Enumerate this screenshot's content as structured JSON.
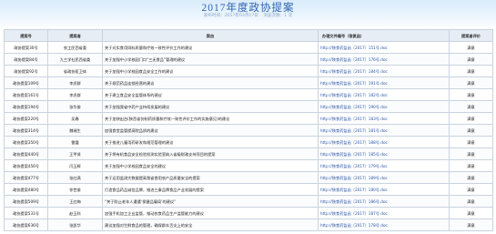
{
  "banner": {
    "title": "2017年度政协提案",
    "meta_left": "发布时间：2017年03月17日",
    "meta_right": "浏览次数：1 次"
  },
  "columns": [
    "提案号",
    "提案者",
    "案由",
    "办理文件编号（答复函）",
    "提案者评价"
  ],
  "rows": [
    {
      "no": "政协提案30号",
      "proposer": "农工民西省委",
      "subject": "关于对实食用饲料质量和疗效一致性评价工作的建议",
      "reply": "http://陕食药监函〔2017〕151号.doc",
      "eval": "满意"
    },
    {
      "no": "政协提案84号",
      "proposer": "九三学社民西省委",
      "subject": "关于加强中小学校园门口“三无食品”管理的建议",
      "reply": "http://陕食药监函〔2017〕176号.doc",
      "eval": "满意"
    },
    {
      "no": "政协提案92号",
      "proposer": "省政协医卫体",
      "subject": "关于加强中小学校园食品安全工作的建议",
      "reply": "http://陕食药监函〔2017〕184号.doc",
      "eval": "满意"
    },
    {
      "no": "政协提案109号",
      "proposer": "李虎群",
      "subject": "关于规范药品连锁经营的建议",
      "reply": "http://陕食药监函〔2017〕191号.doc",
      "eval": "满意"
    },
    {
      "no": "政协提案161号",
      "proposer": "李虎群",
      "subject": "关于建立食品安全监管体系的建议",
      "reply": "http://陕食药监函〔2017〕182号.doc",
      "eval": "满意"
    },
    {
      "no": "政协提案194号",
      "proposer": "张华俊",
      "subject": "关于加强我省中药产业持续发展的建议",
      "reply": "http://陕食药监函〔2017〕190号.doc",
      "eval": "满意"
    },
    {
      "no": "政协提案220号",
      "proposer": "吴春",
      "subject": "关于加快出台(陕西省仿制药质量和疗效一致性评价工作的实施意见)的建议",
      "reply": "http://陕食药监函〔2017〕183号.doc",
      "eval": "满意"
    },
    {
      "no": "政协提案314号",
      "proposer": "魏瑞生",
      "subject": "加强食堂监管提高院品质的建议",
      "reply": "http://陕食药监函〔2017〕181号.doc",
      "eval": "满意"
    },
    {
      "no": "政协提案350号",
      "proposer": "雷霞",
      "subject": "关于推进儿童用药研发和规范管理的建议",
      "reply": "http://陕食药监函〔2017〕188号.doc",
      "eval": "满意"
    },
    {
      "no": "政协提案440号",
      "proposer": "王甲贤",
      "subject": "关于将有机食品安全检验检测实验室纳入省级财政支持项目的提案",
      "reply": "http://陕食药监函〔2017〕185号.doc",
      "eval": "满意"
    },
    {
      "no": "政协提案456号",
      "proposer": "闫玉辉",
      "subject": "关于加强中小学校园食品安全的建议",
      "reply": "http://陕食药监函〔2017〕179号.doc",
      "eval": "满意"
    },
    {
      "no": "政协提案477号",
      "proposer": "张红燕",
      "subject": "关于运用监测大数据提高我省食用农产品质量安全的提案",
      "reply": "http://陕食药监函〔2017〕189号.doc",
      "eval": "满意"
    },
    {
      "no": "政协提案480号",
      "proposer": "徐世俊",
      "subject": "打造食品药品诚信品牌，推进三秦品牌食品产业发展的提案",
      "reply": "http://陕食药监函〔2017〕180号.doc",
      "eval": "满意"
    },
    {
      "no": "政协提案509号",
      "proposer": "王红梅",
      "subject": "“关于防止老年人遭遇‘保健品骗局’的建议”",
      "reply": "http://陕食药监函〔2017〕186号.doc",
      "eval": "满意"
    },
    {
      "no": "政协提案531号",
      "proposer": "赵玉科",
      "subject": "加强手机加工企业监管，推动农食药品生产监管能力的建议",
      "reply": "http://陕食药监函〔2017〕187号.doc",
      "eval": "满意"
    },
    {
      "no": "政协提案636号",
      "proposer": "张凯华",
      "subject": "建议加强对生鲜食品的管理，确保群众舌尖上的安全",
      "reply": "http://陕食药监函〔2017〕178号.doc",
      "eval": "满意"
    }
  ]
}
